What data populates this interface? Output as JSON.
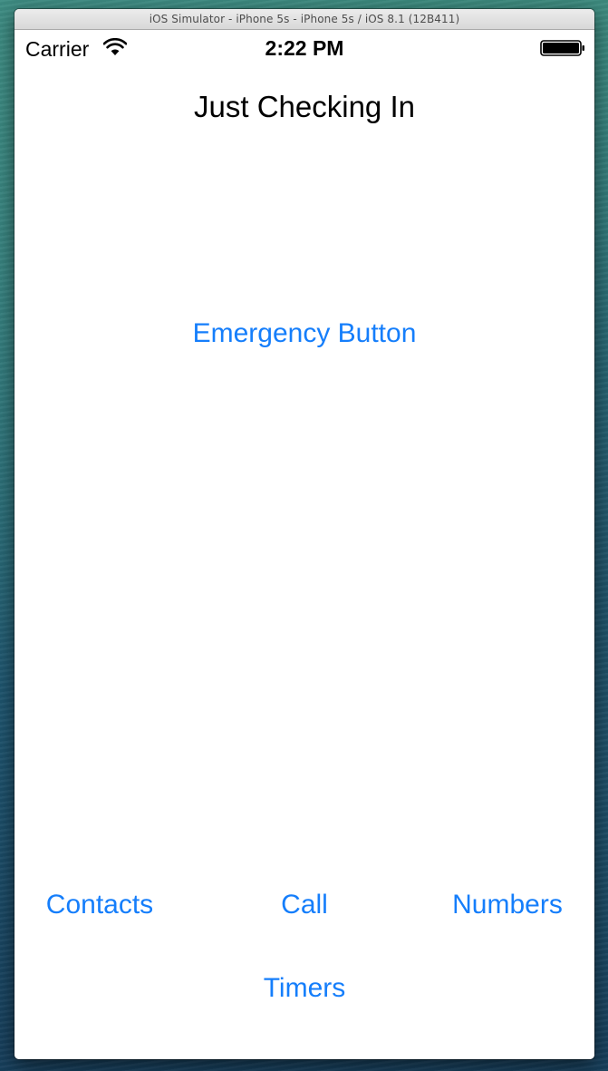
{
  "simulator": {
    "window_title": "iOS Simulator - iPhone 5s - iPhone 5s / iOS 8.1 (12B411)"
  },
  "status_bar": {
    "carrier": "Carrier",
    "time": "2:22 PM",
    "wifi_icon": "wifi-icon",
    "battery_icon": "battery-full-icon"
  },
  "screen": {
    "title": "Just Checking In",
    "emergency_button": "Emergency Button",
    "buttons": {
      "contacts": "Contacts",
      "call": "Call",
      "numbers": "Numbers",
      "timers": "Timers"
    }
  },
  "colors": {
    "accent": "#157efb",
    "text": "#000000",
    "background": "#ffffff"
  }
}
